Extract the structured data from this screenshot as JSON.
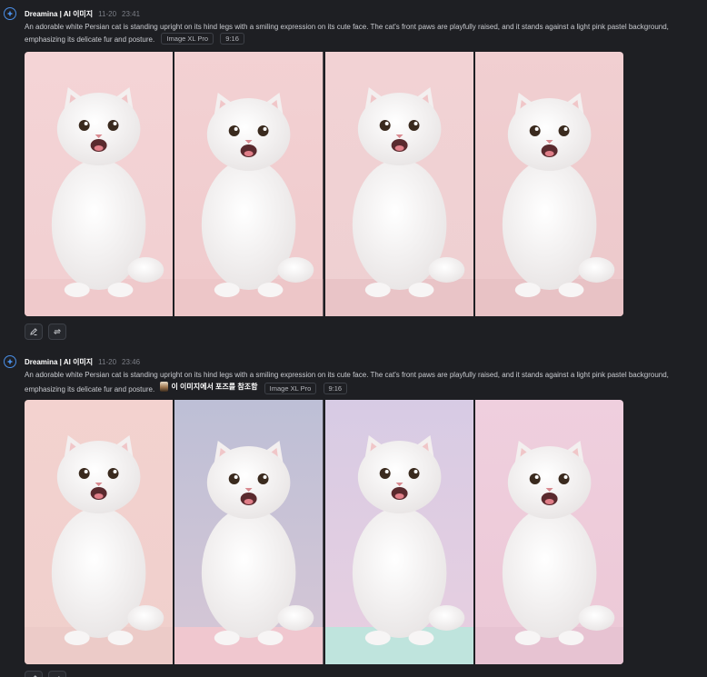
{
  "posts": [
    {
      "author": "Dreamina | AI 이미지",
      "date": "11-20",
      "time": "23:41",
      "prompt": "An adorable white Persian cat is standing upright on its hind legs with a smiling expression on its cute face. The cat's front paws are playfully raised, and it stands against a light pink pastel background, emphasizing its delicate fur and posture.",
      "model_tag": "Image XL Pro",
      "ratio_tag": "9:16",
      "images": [
        {
          "bg_top": "#f4d4d6",
          "bg_bottom": "#f1cfd1",
          "floor": "#efc9cb"
        },
        {
          "bg_top": "#f3d1d3",
          "bg_bottom": "#efcacc",
          "floor": "#edc6c8"
        },
        {
          "bg_top": "#f2d2d4",
          "bg_bottom": "#eed0d2",
          "floor": "#e9c4c7"
        },
        {
          "bg_top": "#f1cfd1",
          "bg_bottom": "#ecc8cb",
          "floor": "#e8c2c5"
        }
      ],
      "actions": [
        {
          "icon": "edit-icon"
        },
        {
          "icon": "regenerate-icon"
        }
      ]
    },
    {
      "author": "Dreamina | AI 이미지",
      "date": "11-20",
      "time": "23:46",
      "prompt": "An adorable white Persian cat is standing upright on its hind legs with a smiling expression on its cute face. The cat's front paws are playfully raised, and it stands against a light pink pastel background, emphasizing its delicate fur and posture.",
      "reference_label": "이 이미지에서 포즈를 참조함",
      "model_tag": "Image XL Pro",
      "ratio_tag": "9:16",
      "images": [
        {
          "bg_top": "#f3d2cf",
          "bg_bottom": "#f0cfcc",
          "floor": "#eccbc8"
        },
        {
          "bg_top": "#bdbfd6",
          "bg_bottom": "#d7c7d6",
          "floor": "#f0c7cf"
        },
        {
          "bg_top": "#d7cbe4",
          "bg_bottom": "#e8cfe0",
          "floor": "#bfe4dd"
        },
        {
          "bg_top": "#efcfde",
          "bg_bottom": "#ecc8d6",
          "floor": "#e7c3d2"
        }
      ],
      "actions": [
        {
          "icon": "edit-icon"
        },
        {
          "icon": "regenerate-icon"
        }
      ]
    }
  ]
}
